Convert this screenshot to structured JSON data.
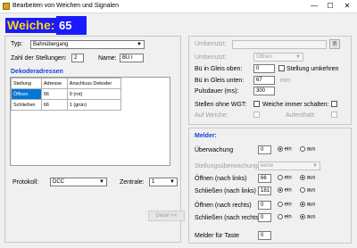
{
  "window": {
    "title": "Bearbeiten von Weichen und Signalen",
    "minimize": "—",
    "maximize": "☐",
    "close": "✕"
  },
  "header": {
    "label": "Weiche:",
    "number": "65"
  },
  "left": {
    "typ_label": "Typ:",
    "typ_value": "Bahnübergang",
    "stellungen_label": "Zahl der Stellungen:",
    "stellungen_value": "2",
    "name_label": "Name:",
    "name_value": "BÜ I",
    "dekoder_title": "Dekoderadressen",
    "table": {
      "headers": [
        "Stellung",
        "Adresse",
        "Anschluss Dekoder"
      ],
      "rows": [
        [
          "Öffnen",
          "66",
          "0 (rot)"
        ],
        [
          "Schließen",
          "66",
          "1 (grün)"
        ]
      ]
    },
    "protokoll_label": "Protokoll:",
    "protokoll_value": "DCC",
    "zentrale_label": "Zentrale:",
    "zentrale_value": "1",
    "detail_button": "Detail <<"
  },
  "top_right": {
    "umbenutzt1_label": "Umbenutzt:",
    "umbenutzt2_label": "Umbenutzt:",
    "umbenutzt2_value": "Öffnen",
    "bu_oben_label": "Bü in Gleis oben:",
    "bu_oben_value": "0",
    "stellung_umkehren": "Stellung umkehren",
    "bu_unten_label": "Bü in Gleis unten:",
    "bu_unten_value": "67",
    "bu_unten_unit": "mm",
    "puls_label": "Pulsdauer (ms):",
    "puls_value": "300",
    "stellen_label": "Stellen ohne WGT:",
    "weiche_immer": "Weiche immer schalten:",
    "sub_label": "Auf Weiche:",
    "sub_label2": "Aufenthalt:"
  },
  "melder": {
    "title": "Melder:",
    "rows": [
      {
        "label": "Überwachung",
        "value": "0",
        "ein": "ein",
        "aus": "aus",
        "selected": "ein"
      },
      {
        "label": "Öffnen (nach links)",
        "value": "66",
        "ein": "ein",
        "aus": "aus",
        "selected": "aus"
      },
      {
        "label": "Schließen (nach links)",
        "value": "181",
        "ein": "ein",
        "aus": "aus",
        "selected": "ein"
      },
      {
        "label": "Öffnen (nach rechts)",
        "value": "0",
        "ein": "ein",
        "aus": "aus",
        "selected": "aus"
      },
      {
        "label": "Schließen (nach rechts)",
        "value": "0",
        "ein": "ein",
        "aus": "aus",
        "selected": "aus"
      }
    ],
    "stellung_label": "Stellungsüberwachung:",
    "stellung_value": "keine",
    "taste_label": "Melder für Taste",
    "taste_value": "0"
  },
  "colors": {
    "accent": "#1a1aff",
    "title_yellow": "#ffd800",
    "section_blue": "#1a3fd4",
    "selection": "#0078d7"
  }
}
